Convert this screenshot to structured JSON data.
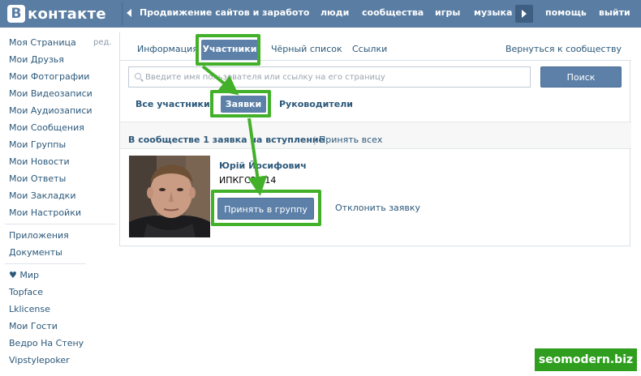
{
  "topbar": {
    "logo_letter": "В",
    "logo_text": "контакте",
    "group_title": "Продвижение сайтов и заработо...",
    "nav": [
      "люди",
      "сообщества",
      "игры",
      "музыка",
      "помощь",
      "выйти"
    ],
    "colors": {
      "bar": "#597da3",
      "text": "#ffffff"
    }
  },
  "sidebar": {
    "edit_label": "ред.",
    "items_main": [
      "Моя Страница",
      "Мои Друзья",
      "Мои Фотографии",
      "Мои Видеозаписи",
      "Мои Аудиозаписи",
      "Мои Сообщения",
      "Мои Группы",
      "Мои Новости",
      "Мои Ответы",
      "Мои Закладки",
      "Мои Настройки"
    ],
    "items_apps": [
      "Приложения",
      "Документы"
    ],
    "items_extra": [
      "♥ Мир",
      "Topface",
      "Lklicense",
      "Мои Гости",
      "Ведро На Стену",
      "Vipstylepoker"
    ]
  },
  "tabs": {
    "items": [
      "Информация",
      "Участники",
      "Чёрный список",
      "Ссылки"
    ],
    "active": "Участники",
    "return_link": "Вернуться к сообществу"
  },
  "search": {
    "placeholder": "Введите имя пользователя или ссылку на его страницу",
    "button": "Поиск"
  },
  "subtabs": {
    "all": "Все участники",
    "requests": "Заявки",
    "leaders": "Руководители"
  },
  "requests_section": {
    "title": "В сообществе 1 заявка на вступление",
    "separator": "|",
    "accept_all": "Принять всех"
  },
  "request": {
    "name": "Юрій Йосифович",
    "subtitle": "ИПКГСЗУ-14",
    "accept_button": "Принять в группу",
    "decline_link": "Отклонить заявку"
  },
  "annotation": {
    "watermark": "seomodern.biz",
    "highlight_color": "#43b02a"
  }
}
